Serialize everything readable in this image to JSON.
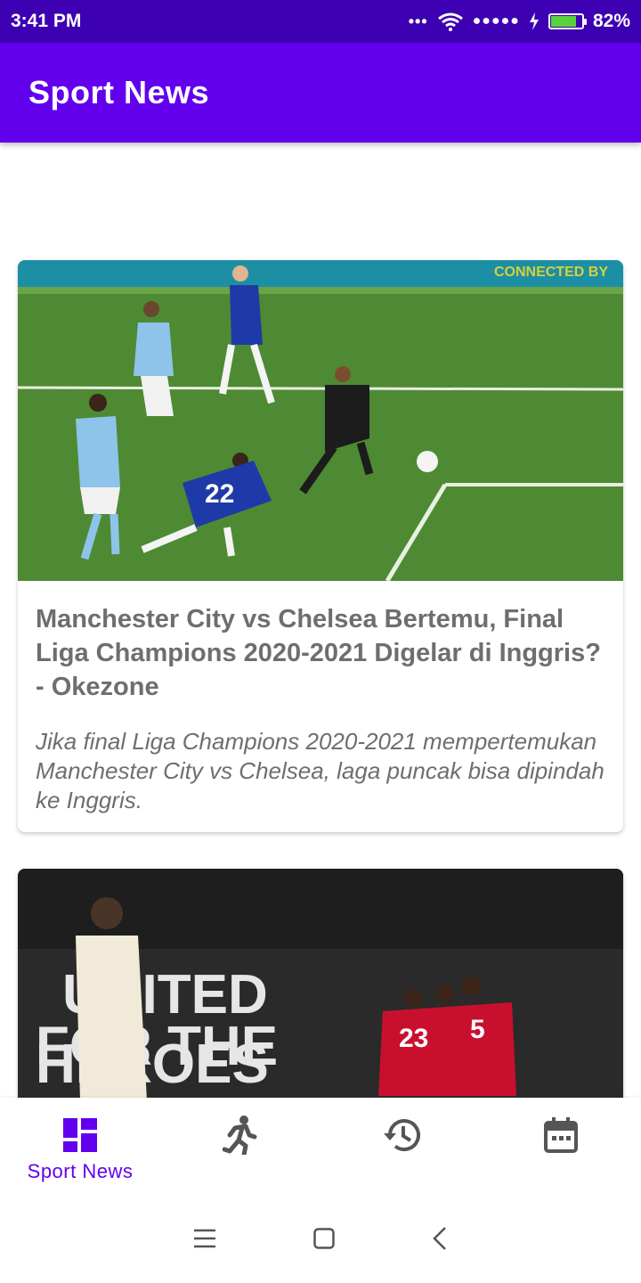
{
  "status_bar": {
    "time": "3:41 PM",
    "battery_percent": "82%",
    "battery_level": 0.82,
    "icons": [
      "more-dots-icon",
      "wifi-icon",
      "signal-dots-icon",
      "charging-icon",
      "battery-icon"
    ]
  },
  "app_bar": {
    "title": "Sport News"
  },
  "articles": [
    {
      "image": "football-match-photo",
      "title": "Manchester City vs Chelsea Bertemu, Final Liga Champions 2020-2021 Digelar di Inggris? - Okezone",
      "description": "Jika final Liga Champions 2020-2021 mempertemukan Manchester City vs Chelsea, laga puncak bisa dipindah ke Inggris.",
      "image_text": "CONNECTED BY"
    },
    {
      "image": "united-celebration-photo",
      "image_text_lines": [
        "UNITED",
        "FOR THE",
        "HEROES"
      ]
    }
  ],
  "bottom_nav": {
    "items": [
      {
        "label": "Sport News",
        "icon": "dashboard-icon",
        "active": true
      },
      {
        "label": "",
        "icon": "running-icon",
        "active": false
      },
      {
        "label": "",
        "icon": "history-icon",
        "active": false
      },
      {
        "label": "",
        "icon": "calendar-icon",
        "active": false
      }
    ]
  },
  "system_nav": {
    "icons": [
      "menu-icon",
      "home-icon",
      "back-icon"
    ]
  },
  "colors": {
    "primary": "#6200ee",
    "status_bar": "#3d00b3",
    "text_gray": "#6e6e6e"
  }
}
